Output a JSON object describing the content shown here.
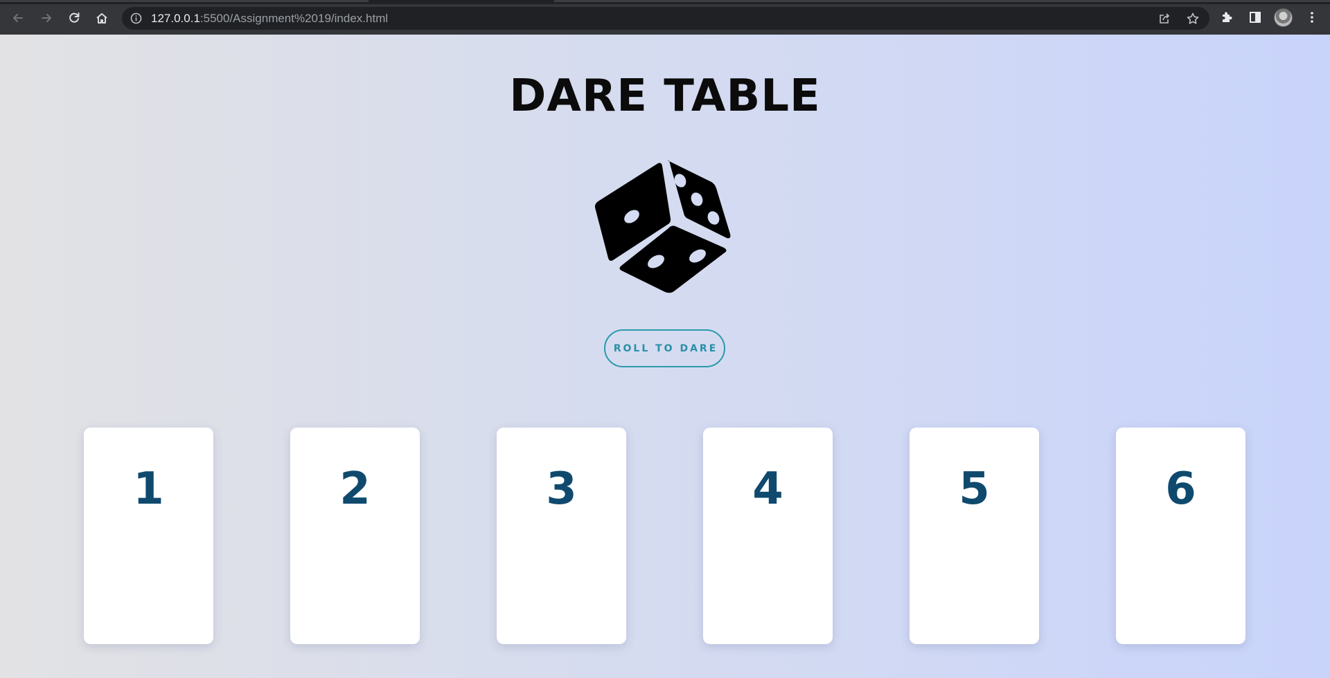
{
  "browser": {
    "url_host": "127.0.0.1",
    "url_rest": ":5500/Assignment%2019/index.html"
  },
  "page": {
    "title": "DARE TABLE",
    "roll_button_label": "ROLL TO DARE",
    "cards": [
      {
        "number": "1"
      },
      {
        "number": "2"
      },
      {
        "number": "3"
      },
      {
        "number": "4"
      },
      {
        "number": "5"
      },
      {
        "number": "6"
      }
    ]
  },
  "colors": {
    "card_number": "#0f4a6e",
    "button_accent": "#2a9aab",
    "background_left": "#e2e2e4",
    "background_right": "#c9d4fb"
  },
  "icons": {
    "dice": "dice-icon",
    "back": "arrow-left-icon",
    "forward": "arrow-right-icon",
    "reload": "reload-icon",
    "home": "home-icon",
    "info": "info-icon",
    "share": "share-icon",
    "bookmark": "star-icon",
    "extensions": "puzzle-icon",
    "side_panel": "side-panel-icon",
    "menu": "kebab-menu-icon"
  }
}
